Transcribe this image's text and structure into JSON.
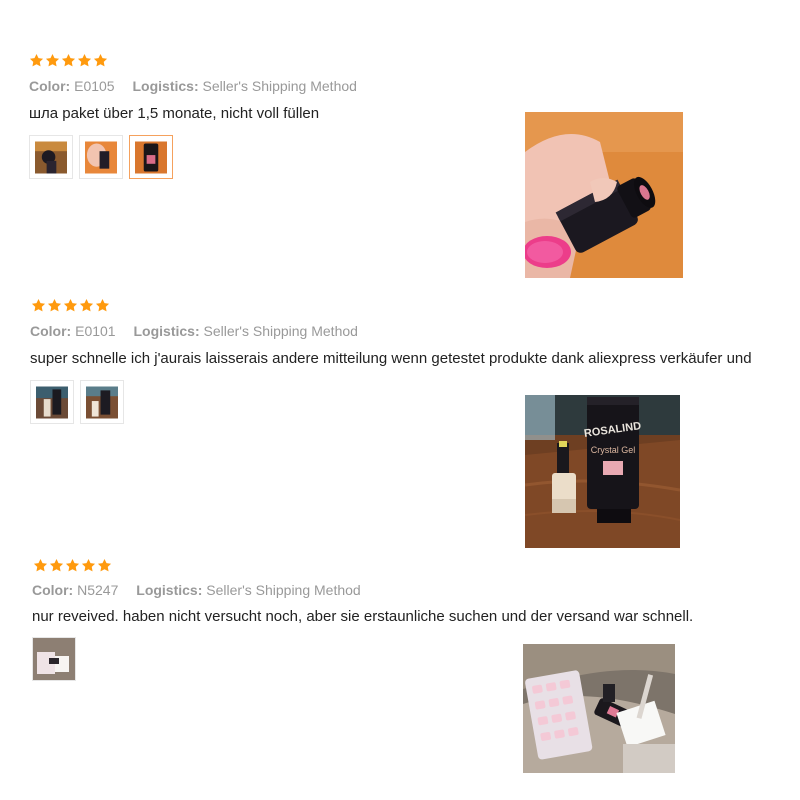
{
  "reviews": [
    {
      "rating": 5,
      "color_label": "Color:",
      "color_value": "E0105",
      "logistics_label": "Logistics:",
      "logistics_value": "Seller's Shipping Method",
      "text": "шла paket über 1,5 monate, nicht voll füllen",
      "thumbnail_count": 3,
      "selected_thumbnail": 3
    },
    {
      "rating": 5,
      "color_label": "Color:",
      "color_value": "E0101",
      "logistics_label": "Logistics:",
      "logistics_value": "Seller's Shipping Method",
      "text": "super schnelle ich j'aurais laisserais andere mitteilung wenn getestet produkte dank aliexpress verkäufer und",
      "thumbnail_count": 2
    },
    {
      "rating": 5,
      "color_label": "Color:",
      "color_value": "N5247",
      "logistics_label": "Logistics:",
      "logistics_value": "Seller's Shipping Method",
      "text": "nur reveived. haben nicht versucht noch, aber sie erstaunliche suchen und der versand war schnell.",
      "thumbnail_count": 1
    }
  ],
  "photos": {
    "r2_brand": "ROSALIND",
    "r2_product": "Crystal Gel"
  },
  "colors": {
    "star": "#ff9a0e",
    "label": "#999999",
    "text": "#222222",
    "selected_border": "#f5a15d"
  }
}
